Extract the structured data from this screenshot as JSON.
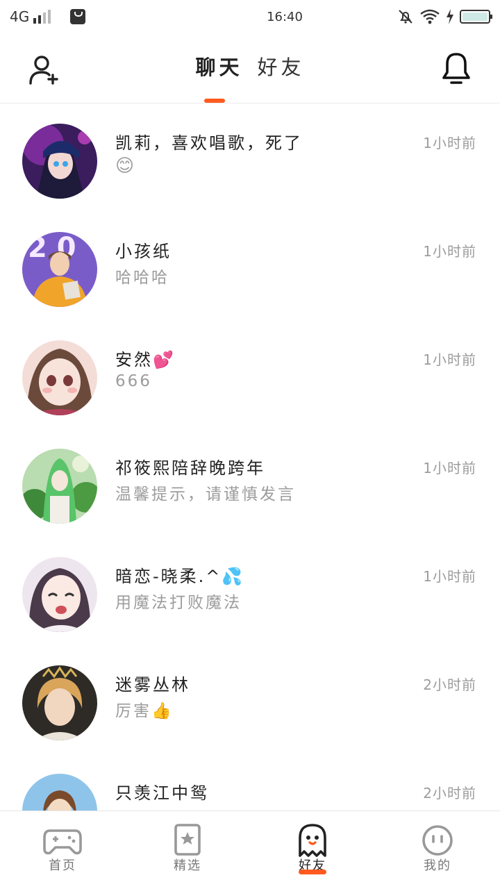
{
  "status_bar": {
    "network": "4G",
    "time": "16:40"
  },
  "header": {
    "tabs": [
      {
        "label": "聊天",
        "active": true
      },
      {
        "label": "好友",
        "active": false
      }
    ],
    "icons": {
      "left": "add-friend-icon",
      "right": "bell-icon"
    },
    "accent_color": "#ff5a1f"
  },
  "chats": [
    {
      "name": "凯莉，喜欢唱歌，死了",
      "message": "😊",
      "time": "1小时前"
    },
    {
      "name": "小孩纸",
      "message": "哈哈哈",
      "time": "1小时前"
    },
    {
      "name": "安然💕",
      "message": "666",
      "time": "1小时前"
    },
    {
      "name": "祁筱熙陪辞晚跨年",
      "message": "温馨提示，请谨慎发言",
      "time": "1小时前"
    },
    {
      "name": "暗恋-晓柔.^💦",
      "message": "用魔法打败魔法",
      "time": "1小时前"
    },
    {
      "name": "迷雾丛林",
      "message": "厉害👍",
      "time": "2小时前"
    },
    {
      "name": "只羡江中鸳",
      "message": "",
      "time": "2小时前"
    }
  ],
  "bottom_nav": [
    {
      "label": "首页",
      "icon": "gamepad-icon",
      "active": false
    },
    {
      "label": "精选",
      "icon": "star-book-icon",
      "active": false
    },
    {
      "label": "好友",
      "icon": "ghost-icon",
      "active": true
    },
    {
      "label": "我的",
      "icon": "face-icon",
      "active": false
    }
  ]
}
